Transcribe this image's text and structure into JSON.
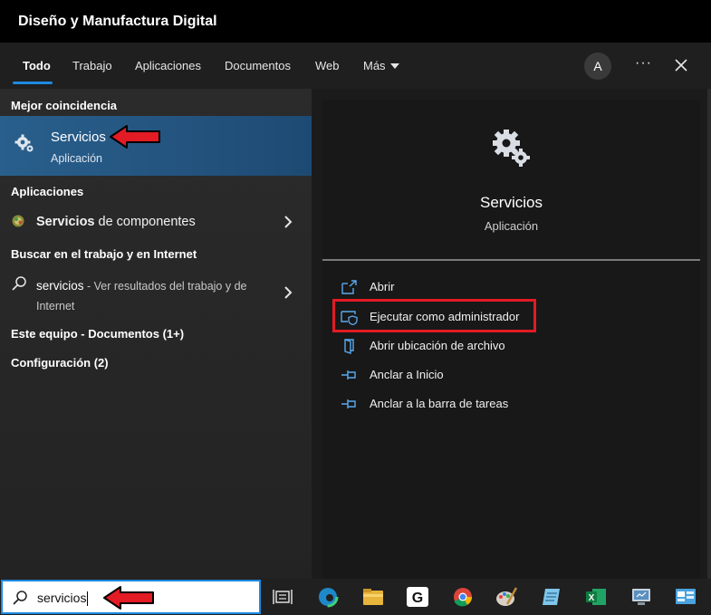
{
  "window": {
    "title": "Diseño y Manufactura Digital"
  },
  "tabs": [
    {
      "label": "Todo",
      "active": true
    },
    {
      "label": "Trabajo"
    },
    {
      "label": "Aplicaciones"
    },
    {
      "label": "Documentos"
    },
    {
      "label": "Web"
    },
    {
      "label": "Más"
    }
  ],
  "header": {
    "avatar_letter": "A",
    "more_glyph": "···"
  },
  "left": {
    "best_match_title": "Mejor coincidencia",
    "best_match": {
      "name": "Servicios",
      "type": "Aplicación",
      "icon": "gear-icon"
    },
    "apps_title": "Aplicaciones",
    "apps": [
      {
        "name_bold": "Servicios",
        "name_rest": " de componentes",
        "icon": "component-services-icon"
      }
    ],
    "web_title": "Buscar en el trabajo y en Internet",
    "web_result": {
      "query": "servicios",
      "hint_line1": " - Ver resultados del trabajo y de",
      "hint_line2": "Internet"
    },
    "this_pc": "Este equipo - Documentos (1+)",
    "settings": "Configuración (2)"
  },
  "preview": {
    "name": "Servicios",
    "type": "Aplicación",
    "actions": [
      {
        "label": "Abrir",
        "icon": "open-icon"
      },
      {
        "label": "Ejecutar como administrador",
        "icon": "shield-icon",
        "highlighted": true
      },
      {
        "label": "Abrir ubicación de archivo",
        "icon": "folder-icon"
      },
      {
        "label": "Anclar a Inicio",
        "icon": "pin-icon"
      },
      {
        "label": "Anclar a la barra de tareas",
        "icon": "pin-icon"
      }
    ]
  },
  "taskbar": {
    "search_value": "servicios",
    "apps": [
      "task-view-icon",
      "edge-icon",
      "file-explorer-icon",
      "g-app-icon",
      "chrome-icon",
      "paint-icon",
      "notepad-icon",
      "excel-icon",
      "remote-icon",
      "control-panel-icon"
    ]
  },
  "colors": {
    "accent": "#1d8ae0",
    "highlight": "#e21b24",
    "selection": "#295f8c"
  }
}
